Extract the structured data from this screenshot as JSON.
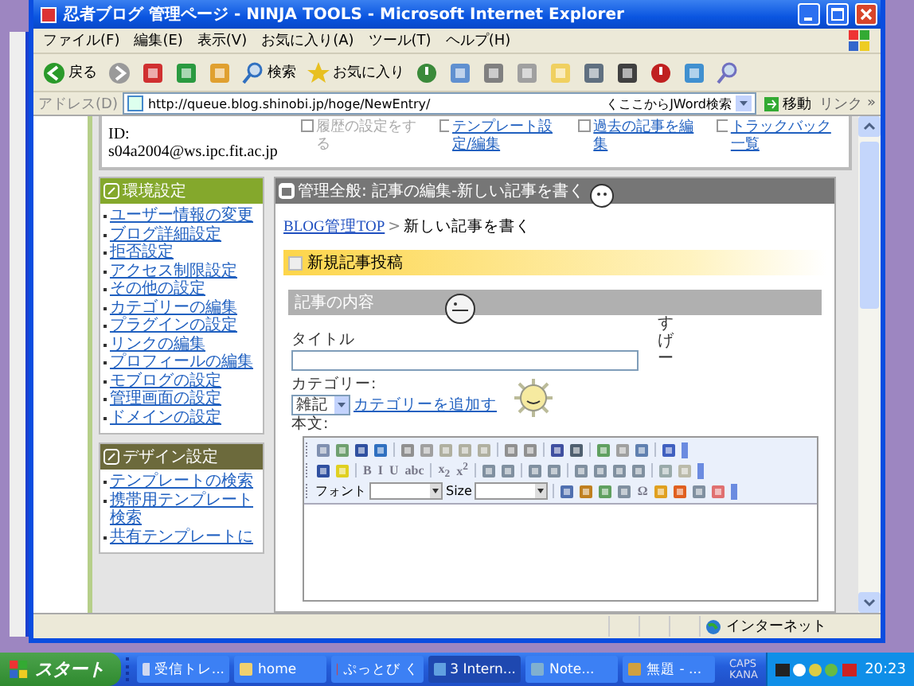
{
  "window": {
    "title": "忍者ブログ 管理ページ - NINJA TOOLS - Microsoft Internet Explorer"
  },
  "menu": [
    "ファイル(F)",
    "編集(E)",
    "表示(V)",
    "お気に入り(A)",
    "ツール(T)",
    "ヘルプ(H)"
  ],
  "toolbar": [
    {
      "kind": "back",
      "label": "戻る"
    },
    {
      "kind": "forward"
    },
    {
      "kind": "stop"
    },
    {
      "kind": "refresh"
    },
    {
      "kind": "home"
    },
    {
      "kind": "search",
      "label": "検索"
    },
    {
      "kind": "favorites",
      "label": "お気に入り"
    },
    {
      "kind": "history"
    },
    {
      "kind": "mail"
    },
    {
      "kind": "print"
    },
    {
      "kind": "edit"
    },
    {
      "kind": "note"
    },
    {
      "kind": "bookmark"
    },
    {
      "kind": "k"
    },
    {
      "kind": "power"
    },
    {
      "kind": "messenger"
    },
    {
      "kind": "research"
    }
  ],
  "address": {
    "label": "アドレス(D)",
    "url": "http://queue.blog.shinobi.jp/hoge/NewEntry/",
    "search": "くここからJWord検索",
    "go": "移動",
    "links": "リンク",
    "more": "»"
  },
  "account": {
    "id_label": "ID:",
    "id": "s04a2004@ws.ipc.fit.ac.jp"
  },
  "top_links": [
    {
      "label": "履歴の設定をする",
      "disabled": true
    },
    {
      "label": "テンプレート設定/編集",
      "disabled": false
    },
    {
      "label": "過去の記事を編集",
      "disabled": false
    },
    {
      "label": "トラックバック一覧",
      "disabled": false
    }
  ],
  "sidebar": [
    {
      "kind": "environment",
      "title": "環境設定",
      "items": [
        "ユーザー情報の変更",
        "ブログ詳細設定",
        "拒否設定",
        "アクセス制限設定",
        "その他の設定",
        "カテゴリーの編集",
        "プラグインの設定",
        "リンクの編集",
        "プロフィールの編集",
        "モブログの設定",
        "管理画面の設定",
        "ドメインの設定"
      ]
    },
    {
      "kind": "design",
      "title": "デザイン設定",
      "items": [
        "テンプレートの検索",
        "携帯用テンプレート検索",
        "共有テンプレートに"
      ]
    }
  ],
  "main": {
    "header": "管理全般: 記事の編集-新しい記事を書く",
    "breadcrumb": {
      "link": "BLOG管理TOP",
      "separator": ">",
      "current": "新しい記事を書く"
    },
    "section": "新規記事投稿",
    "subsection": "記事の内容",
    "title_label": "タイトル",
    "category_label": "カテゴリー:",
    "category_value": "雑記",
    "add_category": "カテゴリーを追加す",
    "body_label": "本文:",
    "overlay_text": "すげー"
  },
  "editor": {
    "toolbars": [
      {
        "buttons": [
          {
            "kind": "doc"
          },
          {
            "kind": "preview"
          },
          {
            "kind": "save"
          },
          {
            "kind": "template"
          },
          {
            "kind": "sep"
          },
          {
            "kind": "cut"
          },
          {
            "kind": "copy"
          },
          {
            "kind": "paste"
          },
          {
            "kind": "paste"
          },
          {
            "kind": "paste"
          },
          {
            "kind": "sep"
          },
          {
            "kind": "undo"
          },
          {
            "kind": "redo"
          },
          {
            "kind": "sep"
          },
          {
            "kind": "find"
          },
          {
            "kind": "replace"
          },
          {
            "kind": "sep"
          },
          {
            "kind": "table"
          },
          {
            "kind": "eraser"
          },
          {
            "kind": "source"
          },
          {
            "kind": "sep"
          },
          {
            "kind": "help"
          }
        ]
      },
      {
        "buttons": [
          {
            "kind": "textcolor"
          },
          {
            "kind": "bgcolor"
          },
          {
            "kind": "sep"
          },
          {
            "kind": "text",
            "label": "B"
          },
          {
            "kind": "text",
            "label": "I"
          },
          {
            "kind": "text",
            "label": "U"
          },
          {
            "kind": "text",
            "label": "abc"
          },
          {
            "kind": "sep"
          },
          {
            "kind": "text",
            "label": "x$_{2}$"
          },
          {
            "kind": "text",
            "label": "x$^{2}$"
          },
          {
            "kind": "sep"
          },
          {
            "kind": "list"
          },
          {
            "kind": "list"
          },
          {
            "kind": "sep"
          },
          {
            "kind": "indent"
          },
          {
            "kind": "indent"
          },
          {
            "kind": "sep"
          },
          {
            "kind": "align"
          },
          {
            "kind": "align"
          },
          {
            "kind": "align"
          },
          {
            "kind": "align"
          },
          {
            "kind": "sep"
          },
          {
            "kind": "link"
          },
          {
            "kind": "anchor"
          }
        ]
      },
      {
        "buttons": [
          {
            "kind": "label",
            "label": "フォント"
          },
          {
            "kind": "select"
          },
          {
            "kind": "label",
            "label": "Size"
          },
          {
            "kind": "select"
          },
          {
            "kind": "sep"
          },
          {
            "kind": "image"
          },
          {
            "kind": "flash"
          },
          {
            "kind": "table"
          },
          {
            "kind": "rule"
          },
          {
            "kind": "text",
            "label": "Ω"
          },
          {
            "kind": "info"
          },
          {
            "kind": "media"
          },
          {
            "kind": "rule"
          },
          {
            "kind": "smiley"
          }
        ]
      }
    ]
  },
  "status_bar": {
    "zone": "インターネット"
  },
  "taskbar": {
    "start": "スタート",
    "items": [
      {
        "kind": "mail",
        "label": "受信トレ...",
        "selected": false
      },
      {
        "kind": "folder",
        "label": "home",
        "selected": false
      },
      {
        "kind": "app",
        "label": "ぷっとび く",
        "selected": false
      },
      {
        "kind": "ie",
        "label": "3 Intern...",
        "selected": true
      },
      {
        "kind": "note",
        "label": "Note...",
        "selected": false
      },
      {
        "kind": "paint",
        "label": "無題 - ...",
        "selected": false
      }
    ],
    "caps": "CAPS",
    "kana": "KANA",
    "time": "20:23"
  }
}
